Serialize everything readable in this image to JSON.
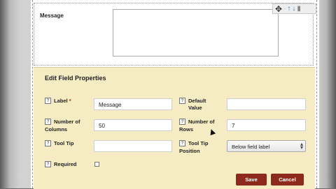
{
  "message_field": {
    "label": "Message"
  },
  "toolbar": {
    "icons": [
      "move-icon",
      "arrow-up-icon",
      "arrow-down-icon",
      "trash-icon"
    ]
  },
  "panel": {
    "title": "Edit Field Properties",
    "help_glyph": "?",
    "label": {
      "label": "Label",
      "required_mark": "*",
      "value": "Message"
    },
    "default_value": {
      "label_line1": "Default",
      "label_line2": "Value",
      "value": ""
    },
    "num_columns": {
      "label_line1": "Number of",
      "label_line2": "Columns",
      "value": "50"
    },
    "num_rows": {
      "label_line1": "Number of",
      "label_line2": "Rows",
      "value": "7"
    },
    "tooltip": {
      "label": "Tool Tip",
      "value": ""
    },
    "tooltip_position": {
      "label_line1": "Tool Tip",
      "label_line2": "Position",
      "value": "Below field label"
    },
    "required": {
      "label": "Required",
      "checked": false
    },
    "save_label": "Save",
    "cancel_label": "Cancel"
  },
  "colors": {
    "panel_bg": "#f5ecc4",
    "button_bg": "#8e2a1c",
    "arrow_blue": "#3a78b5"
  }
}
